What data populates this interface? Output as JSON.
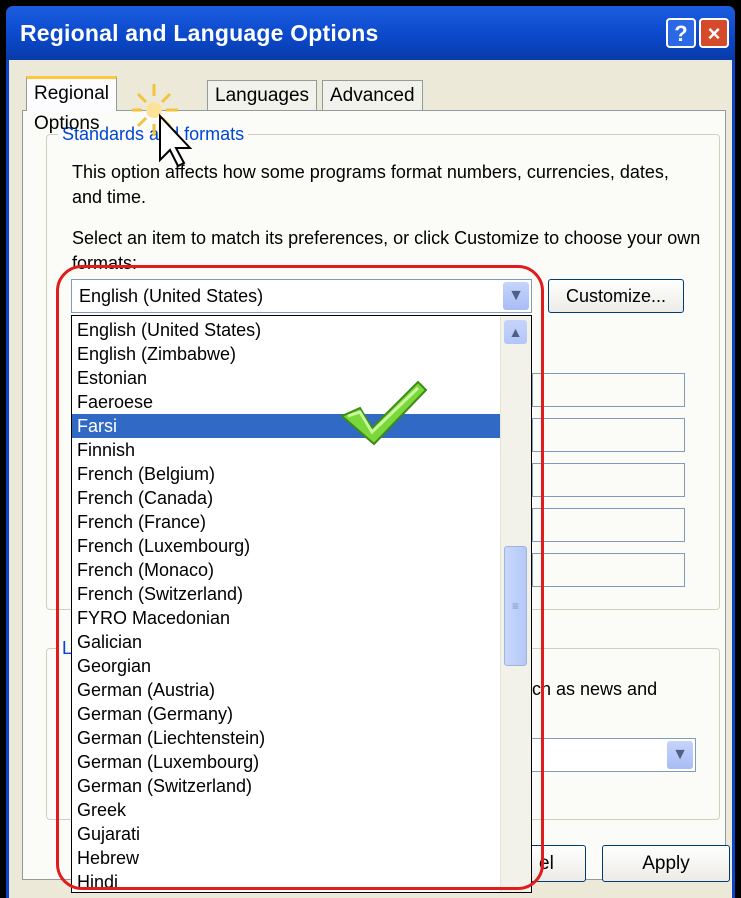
{
  "window": {
    "title": "Regional and Language Options",
    "help_glyph": "?",
    "close_glyph": "×"
  },
  "tabs": [
    {
      "label": "Regional Options",
      "active": true
    },
    {
      "label": "Languages",
      "active": false
    },
    {
      "label": "Advanced",
      "active": false
    }
  ],
  "standards": {
    "legend": "Standards and formats",
    "description": "This option affects how some programs format numbers, currencies, dates, and time.",
    "instruction": "Select an item to match its preferences, or click Customize to choose your own formats:",
    "selected_format": "English (United States)",
    "customize_label": "Customize..."
  },
  "format_list": {
    "items": [
      "English (United States)",
      "English (Zimbabwe)",
      "Estonian",
      "Faeroese",
      "Farsi",
      "Finnish",
      "French (Belgium)",
      "French (Canada)",
      "French (France)",
      "French (Luxembourg)",
      "French (Monaco)",
      "French (Switzerland)",
      "FYRO Macedonian",
      "Galician",
      "Georgian",
      "German (Austria)",
      "German (Germany)",
      "German (Liechtenstein)",
      "German (Luxembourg)",
      "German (Switzerland)",
      "Greek",
      "Gujarati",
      "Hebrew",
      "Hindi"
    ],
    "selected_index": 4
  },
  "location": {
    "legend": "L",
    "description_fragment": "uch as news and"
  },
  "buttons": {
    "cancel_fragment": "el",
    "apply_label": "Apply"
  },
  "colors": {
    "titlebar": "#0a47c8",
    "highlight": "#e01c1c",
    "selection": "#316ac5",
    "checkmark": "#6fcf2a"
  }
}
